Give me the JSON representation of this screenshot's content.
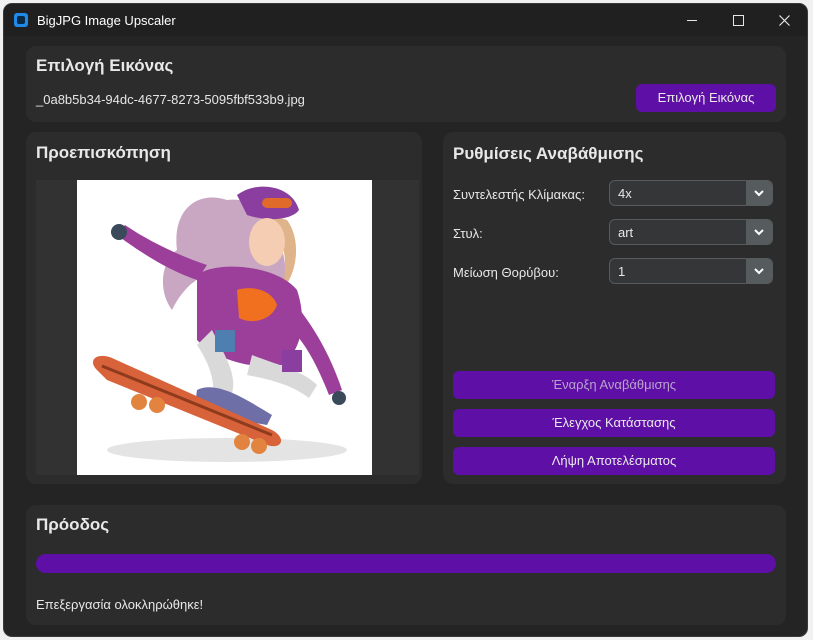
{
  "window": {
    "title": "BigJPG Image Upscaler",
    "app_icon": "app-icon"
  },
  "image_section": {
    "heading": "Επιλογή Εικόνας",
    "file_name": "_0a8b5b34-94dc-4677-8273-5095fbf533b9.jpg",
    "select_button": "Επιλογή Εικόνας"
  },
  "preview": {
    "heading": "Προεπισκόπηση"
  },
  "settings": {
    "heading": "Ρυθμίσεις Αναβάθμισης",
    "scale_label": "Συντελεστής Κλίμακας:",
    "scale_value": "4x",
    "style_label": "Στυλ:",
    "style_value": "art",
    "noise_label": "Μείωση Θορύβου:",
    "noise_value": "1",
    "start_button": "Έναρξη Αναβάθμισης",
    "status_button": "Έλεγχος Κατάστασης",
    "download_button": "Λήψη Αποτελέσματος"
  },
  "progress": {
    "heading": "Πρόοδος",
    "value": 1.0,
    "status_text": "Επεξεργασία ολοκληρώθηκε!"
  },
  "colors": {
    "accent": "#5e0fa6",
    "background": "#242424",
    "panel": "#2c2c2c"
  }
}
